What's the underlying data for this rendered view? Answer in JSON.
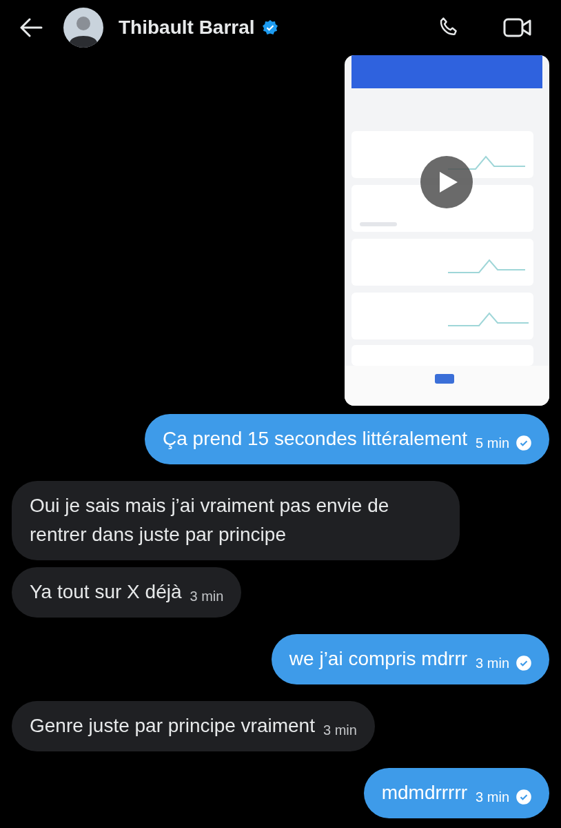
{
  "header": {
    "name": "Thibault Barral",
    "verified": true
  },
  "media": {
    "kind": "video"
  },
  "messages": [
    {
      "kind": "sent",
      "text": "Ça prend 15 secondes littéralement",
      "time": "5 min",
      "read": true
    },
    {
      "kind": "received",
      "text": "Oui je sais mais j’ai vraiment pas envie de rentrer dans juste par principe"
    },
    {
      "kind": "received",
      "text": "Ya tout sur X déjà",
      "time": "3 min"
    },
    {
      "kind": "sent",
      "text": "we j’ai compris mdrrr",
      "time": "3 min",
      "read": true
    },
    {
      "kind": "received",
      "text": "Genre juste par principe vraiment",
      "time": "3 min"
    },
    {
      "kind": "sent",
      "text": "mdmdrrrrr",
      "time": "3 min",
      "read": true
    }
  ]
}
